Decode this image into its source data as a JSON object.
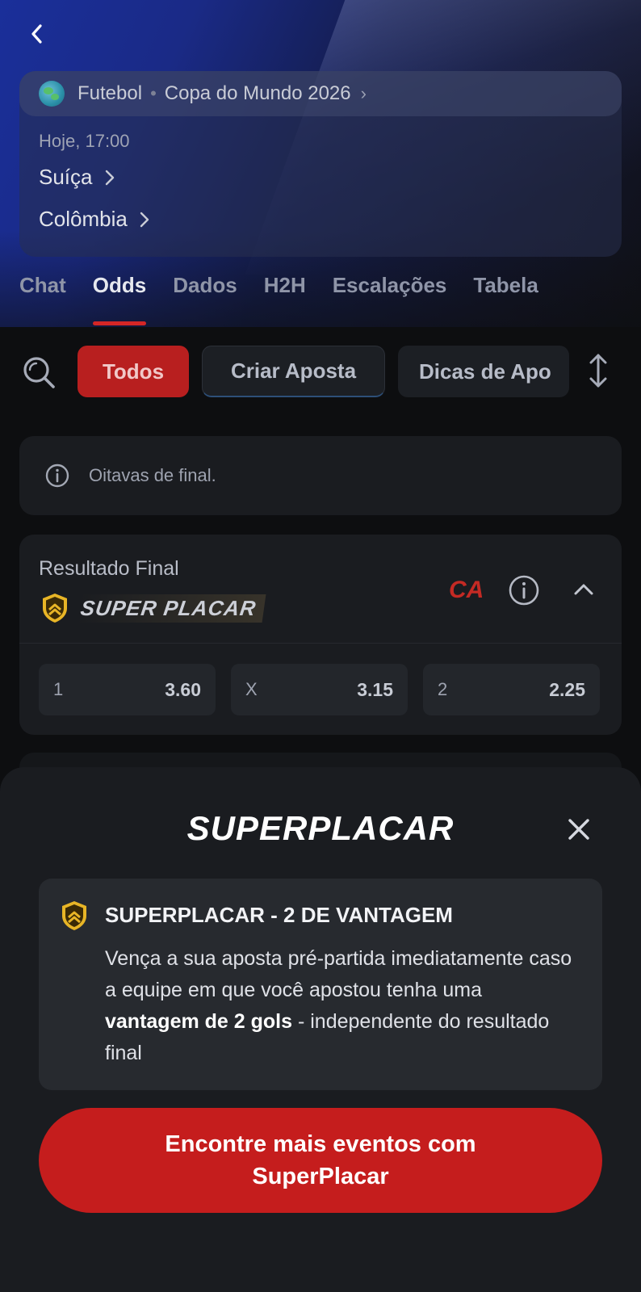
{
  "header": {
    "sport": "Futebol",
    "separator": "•",
    "competition": "Copa do Mundo 2026",
    "match_time": "Hoje, 17:00",
    "home_team": "Suíça",
    "away_team": "Colômbia"
  },
  "tabs": [
    {
      "label": "Chat",
      "active": false
    },
    {
      "label": "Odds",
      "active": true
    },
    {
      "label": "Dados",
      "active": false
    },
    {
      "label": "H2H",
      "active": false
    },
    {
      "label": "Escalações",
      "active": false
    },
    {
      "label": "Tabela",
      "active": false
    }
  ],
  "filters": {
    "todos": "Todos",
    "criar_aposta": "Criar Aposta",
    "dicas": "Dicas de Apo"
  },
  "info_banner": {
    "text": "Oitavas de final."
  },
  "market": {
    "title": "Resultado Final",
    "badge": "SUPER PLACAR",
    "bookmaker": "CA",
    "odds": [
      {
        "label": "1",
        "value": "3.60"
      },
      {
        "label": "X",
        "value": "3.15"
      },
      {
        "label": "2",
        "value": "2.25"
      }
    ]
  },
  "sheet": {
    "title": "SUPERPLACAR",
    "promo_heading": "SUPERPLACAR - 2 DE VANTAGEM",
    "promo_body_1": "Vença a sua aposta pré-partida imediatamente caso a equipe em que você apostou tenha uma ",
    "promo_body_bold": "vantagem de 2 gols",
    "promo_body_2": " - independente do resultado final",
    "cta_label": "Encontre mais eventos com SuperPlacar"
  },
  "colors": {
    "accent_red": "#c51d1d",
    "shield_gold": "#e8b526"
  }
}
